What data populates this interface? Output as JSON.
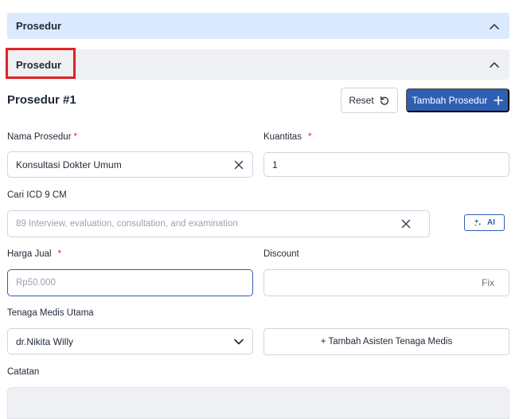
{
  "sections": [
    {
      "title": "Prosedur"
    },
    {
      "title": "Prosedur"
    }
  ],
  "procedure": {
    "title": "Prosedur #1",
    "reset_label": "Reset",
    "add_label": "Tambah Prosedur"
  },
  "form": {
    "nama_prosedur": {
      "label": "Nama Prosedur",
      "required": "*",
      "value": "Konsultasi Dokter Umum"
    },
    "kuantitas": {
      "label": "Kuantitas",
      "required": "*",
      "value": "1"
    },
    "icd": {
      "label": "Cari ICD 9 CM",
      "placeholder": "89 Interview, evaluation, consultation, and examination",
      "ai_label": "AI"
    },
    "harga_jual": {
      "label": "Harga Jual",
      "required": "*",
      "placeholder": "Rp50.000"
    },
    "discount": {
      "label": "Discount",
      "suffix": "Fix"
    },
    "tenaga_medis": {
      "label": "Tenaga Medis Utama",
      "value": "dr.Nikita Willy"
    },
    "assist_label": "+ Tambah Asisten Tenaga Medis",
    "catatan": {
      "label": "Catatan"
    }
  },
  "colors": {
    "primary": "#2f5fb3",
    "required": "#e02424",
    "highlight": "#e02424",
    "section_bar_active": "#dbeafe",
    "section_bar": "#eef0f3"
  }
}
